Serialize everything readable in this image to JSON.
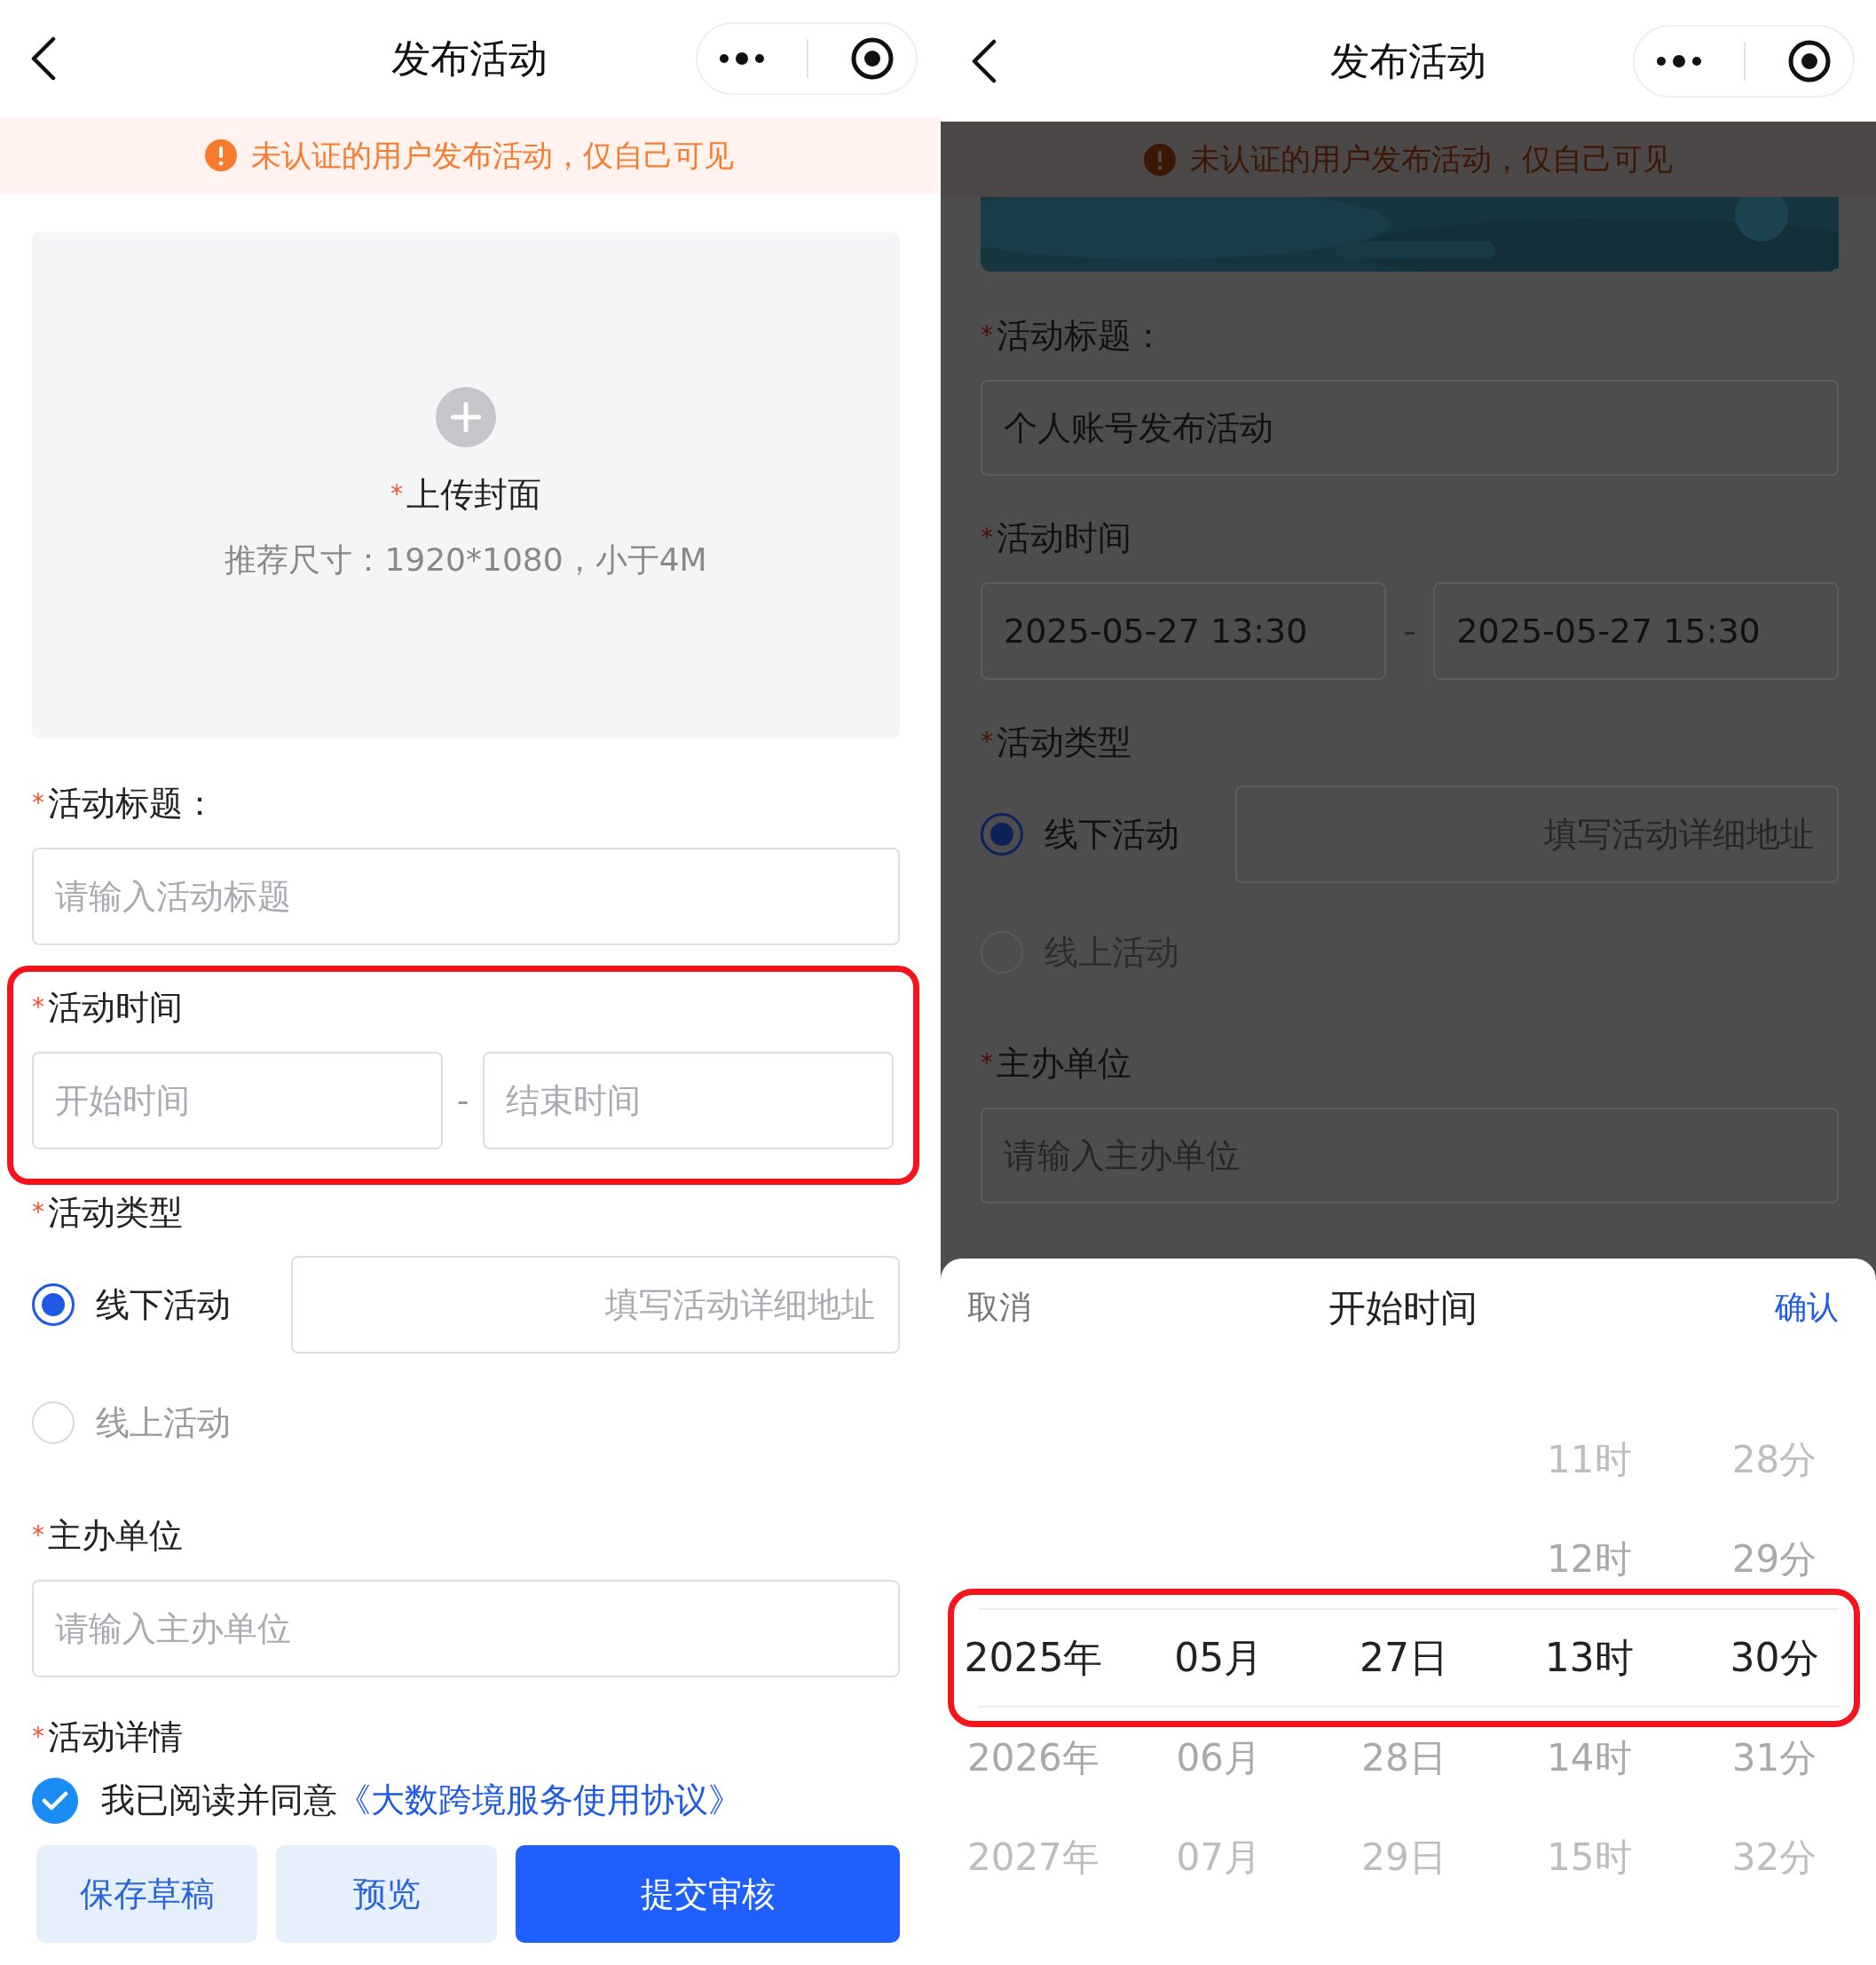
{
  "screens": [
    {
      "nav": {
        "title": "发布活动"
      },
      "notice": "未认证的用户发布活动，仅自己可见",
      "dimmed": false,
      "cover": {
        "kind": "upload",
        "label": "上传封面",
        "mark": "*",
        "hint": "推荐尺寸：1920*1080，小于4M"
      },
      "fields": [
        {
          "kind": "text",
          "label": "活动标题：",
          "mark": "*",
          "placeholder": "请输入活动标题"
        },
        {
          "kind": "range",
          "label": "活动时间",
          "mark": "*",
          "highlighted": true,
          "separator": "-",
          "start": {
            "placeholder": "开始时间"
          },
          "end": {
            "placeholder": "结束时间"
          }
        },
        {
          "kind": "type",
          "label": "活动类型",
          "mark": "*",
          "options": [
            {
              "label": "线下活动",
              "selected": true,
              "address_placeholder": "填写活动详细地址"
            },
            {
              "label": "线上活动",
              "selected": false
            }
          ]
        },
        {
          "kind": "text",
          "label": "主办单位",
          "mark": "*",
          "placeholder": "请输入主办单位"
        },
        {
          "kind": "section",
          "label": "活动详情",
          "mark": "*"
        }
      ],
      "agreement": {
        "checked": true,
        "text": "我已阅读并同意",
        "link": "《大数跨境服务使用协议》"
      },
      "buttons": [
        {
          "label": "保存草稿",
          "kind": "secondary"
        },
        {
          "label": "预览",
          "kind": "secondary"
        },
        {
          "label": "提交审核",
          "kind": "primary"
        }
      ]
    },
    {
      "nav": {
        "title": "发布活动"
      },
      "notice": "未认证的用户发布活动，仅自己可见",
      "dimmed": true,
      "cover": {
        "kind": "picture"
      },
      "fields": [
        {
          "kind": "text",
          "label": "活动标题：",
          "mark": "*",
          "value": "个人账号发布活动"
        },
        {
          "kind": "range",
          "label": "活动时间",
          "mark": "*",
          "separator": "-",
          "start": {
            "value": "2025-05-27 13:30"
          },
          "end": {
            "value": "2025-05-27 15:30"
          }
        },
        {
          "kind": "type",
          "label": "活动类型",
          "mark": "*",
          "options": [
            {
              "label": "线下活动",
              "selected": true,
              "address_placeholder": "填写活动详细地址"
            },
            {
              "label": "线上活动",
              "selected": false
            }
          ]
        },
        {
          "kind": "text",
          "label": "主办单位",
          "mark": "*",
          "placeholder": "请输入主办单位"
        }
      ],
      "picker": {
        "cancel": "取消",
        "title": "开始时间",
        "confirm": "确认",
        "highlighted": true,
        "columns": [
          {
            "items": [
              {
                "label": "2025年",
                "selected": true
              },
              {
                "label": "2026年",
                "selected": false
              },
              {
                "label": "2027年",
                "selected": false
              }
            ]
          },
          {
            "items": [
              {
                "label": "05月",
                "selected": true
              },
              {
                "label": "06月",
                "selected": false
              },
              {
                "label": "07月",
                "selected": false
              }
            ]
          },
          {
            "items": [
              {
                "label": "27日",
                "selected": true
              },
              {
                "label": "28日",
                "selected": false
              },
              {
                "label": "29日",
                "selected": false
              }
            ]
          },
          {
            "items": [
              {
                "label": "11时",
                "selected": false
              },
              {
                "label": "12时",
                "selected": false
              },
              {
                "label": "13时",
                "selected": true
              },
              {
                "label": "14时",
                "selected": false
              },
              {
                "label": "15时",
                "selected": false
              }
            ]
          },
          {
            "items": [
              {
                "label": "28分",
                "selected": false
              },
              {
                "label": "29分",
                "selected": false
              },
              {
                "label": "30分",
                "selected": true
              },
              {
                "label": "31分",
                "selected": false
              },
              {
                "label": "32分",
                "selected": false
              }
            ]
          }
        ]
      }
    }
  ]
}
